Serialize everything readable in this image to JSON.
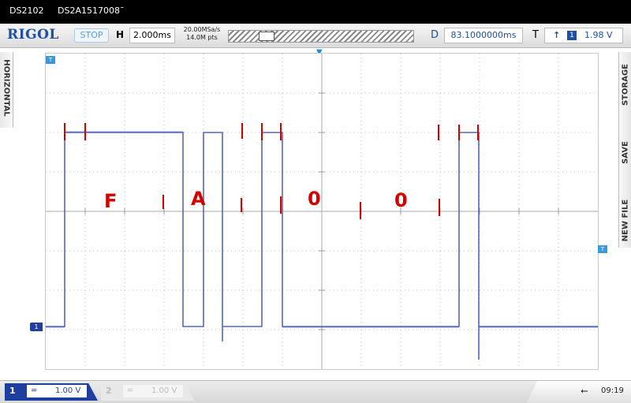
{
  "titlebar": {
    "model": "DS2102",
    "serial": "DS2A1517008ˉ"
  },
  "header": {
    "brand": "RIGOL",
    "run_state": "STOP",
    "horizontal_label": "H",
    "timebase": "2.000ms",
    "sample_rate": "20.00MSa/s",
    "memory_points": "14.0M pts",
    "delay_label": "D",
    "delay_value": "83.1000000ms",
    "trigger_label": "T",
    "trigger_edge": "↑",
    "trigger_channel": "1",
    "trigger_level": "1.98 V"
  },
  "markers": {
    "trigger_position": "▼",
    "t_top": "T",
    "t_right": "T",
    "ch1": "1"
  },
  "annotations": {
    "c1": "F",
    "c2": "A",
    "c3": "0",
    "c4": "0"
  },
  "side_tabs": {
    "left": "HORIZONTAL",
    "storage": "STORAGE",
    "save": "SAVE",
    "new_file": "NEW FILE"
  },
  "bottom": {
    "ch1": {
      "number": "1",
      "coupling": "═",
      "scale": "1.00 V"
    },
    "ch2": {
      "number": "2",
      "coupling": "═",
      "scale": "1.00 V"
    },
    "usb_icon": "usb-icon",
    "clock": "09:19"
  },
  "colors": {
    "trace": "#5566c0",
    "annotation": "#d40000",
    "brand": "#1f4fa0"
  }
}
